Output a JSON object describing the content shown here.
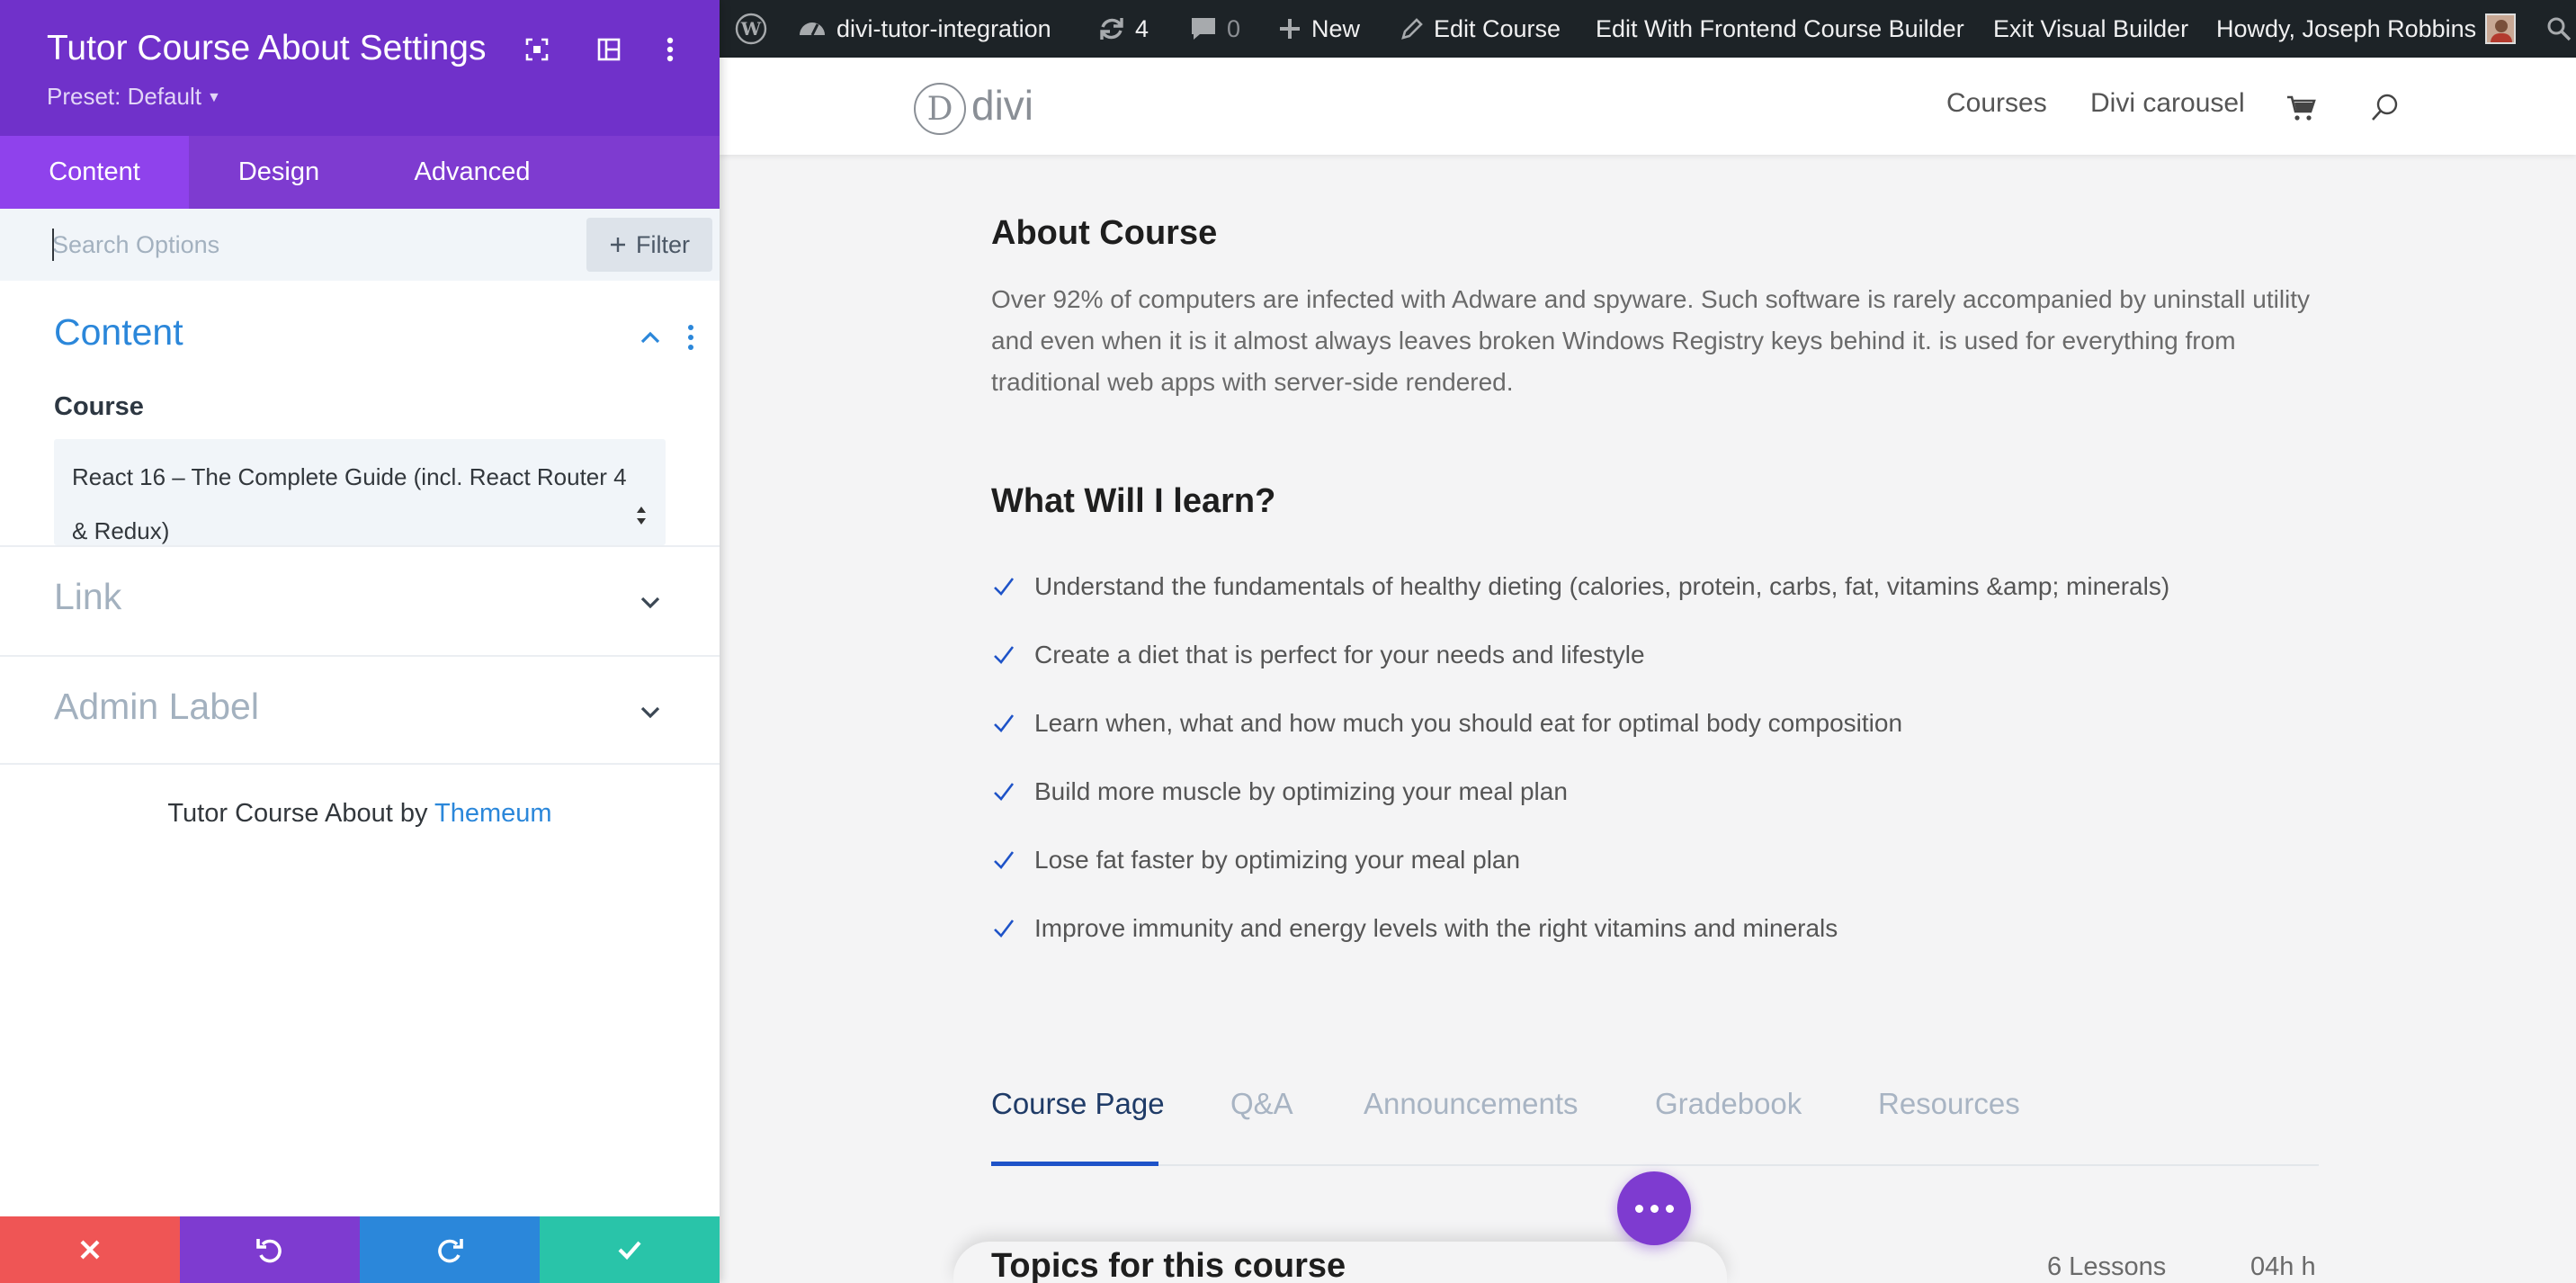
{
  "panel": {
    "title": "Tutor Course About Settings",
    "preset": "Preset: Default",
    "tabs": [
      {
        "label": "Content",
        "active": true
      },
      {
        "label": "Design",
        "active": false
      },
      {
        "label": "Advanced",
        "active": false
      }
    ],
    "search_placeholder": "Search Options",
    "filter_label": "Filter",
    "sections": {
      "content": "Content",
      "link": "Link",
      "admin_label": "Admin Label"
    },
    "course_label": "Course",
    "course_value": "React 16 – The Complete Guide (incl. React Router 4 & Redux)",
    "credit_prefix": "Tutor Course About by",
    "credit_link": "Themeum"
  },
  "adminbar": {
    "site_name": "divi-tutor-integration",
    "updates_count": "4",
    "comments_count": "0",
    "new_label": "New",
    "edit_course": "Edit Course",
    "edit_frontend": "Edit With Frontend Course Builder",
    "exit_builder": "Exit Visual Builder",
    "howdy": "Howdy, Joseph Robbins"
  },
  "site": {
    "logo_letter": "D",
    "logo_text": "divi",
    "nav": [
      "Courses",
      "Divi carousel"
    ]
  },
  "about": {
    "heading": "About Course",
    "text": "Over 92% of computers are infected with Adware and spyware. Such software is rarely accompanied by uninstall utility and even when it is it almost always leaves broken Windows Registry keys behind it. is used for everything from traditional web apps with server-side rendered."
  },
  "learn": {
    "heading": "What Will I learn?",
    "items": [
      "Understand the fundamentals of healthy dieting (calories, protein, carbs, fat, vitamins &amp; minerals)",
      "Create a diet that is perfect for your needs and lifestyle",
      "Learn when, what and how much you should eat for optimal body composition",
      "Build more muscle by optimizing your meal plan",
      "Lose fat faster by optimizing your meal plan",
      "Improve immunity and energy levels with the right vitamins and minerals"
    ]
  },
  "course_tabs": [
    "Course Page",
    "Q&A",
    "Announcements",
    "Gradebook",
    "Resources"
  ],
  "topics": {
    "heading": "Topics for this course",
    "lessons": "6 Lessons",
    "duration": "04h h"
  },
  "colors": {
    "panel_purple": "#7031ca",
    "tab_purple": "#7e3bd0",
    "active_blue": "#2b87da",
    "cancel_red": "#ef5555",
    "undo_purple": "#7e3bd0",
    "redo_blue": "#2b87da",
    "save_green": "#29c4a9"
  },
  "icons": {
    "focus": "focus-icon",
    "split": "split-view-icon",
    "menu": "more-vertical-icon",
    "cancel": "close-icon",
    "undo": "undo-icon",
    "redo": "redo-icon",
    "save": "check-icon"
  }
}
